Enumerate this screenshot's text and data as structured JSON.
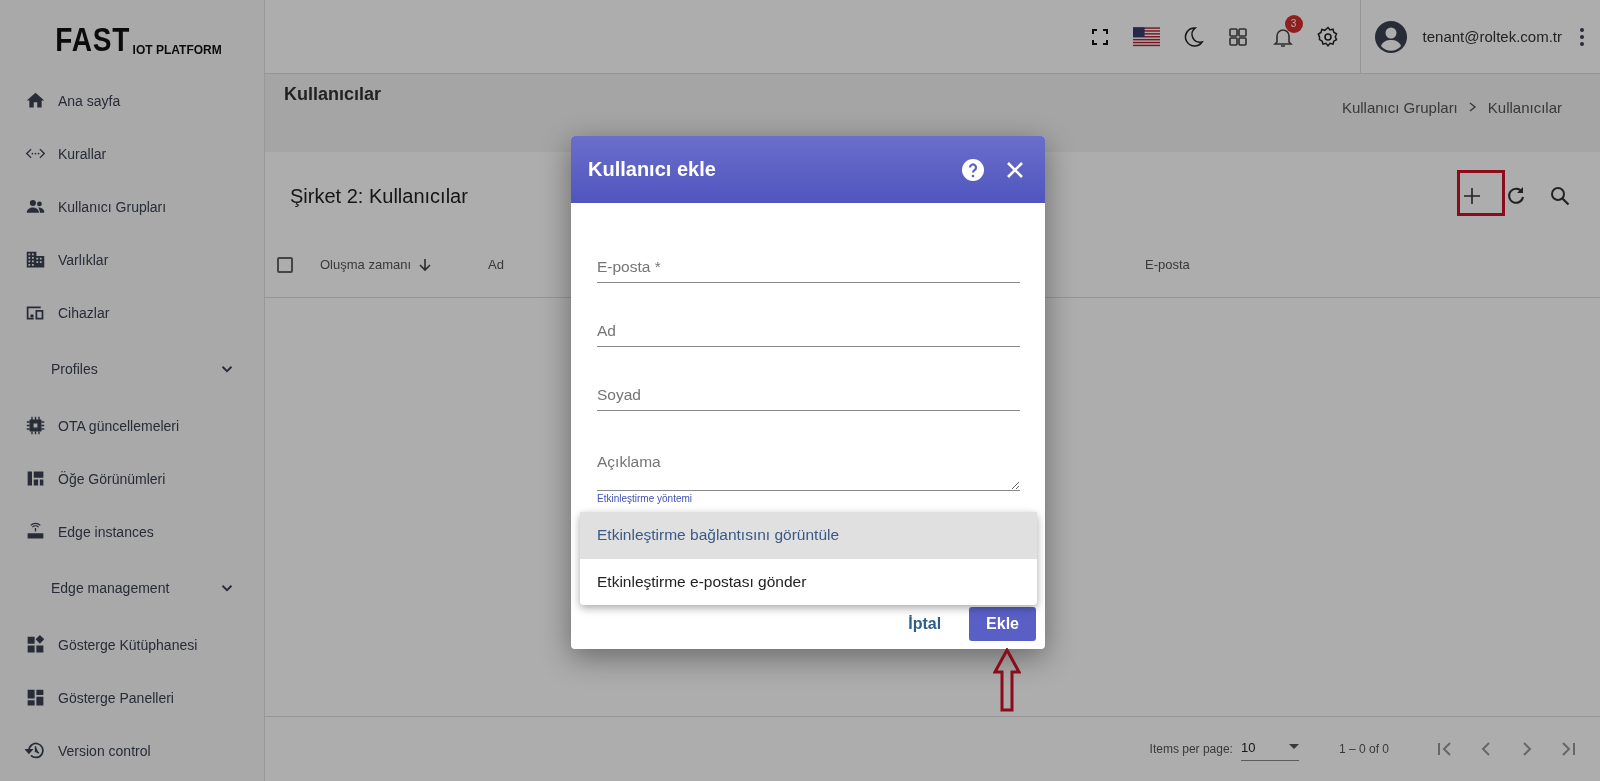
{
  "header": {
    "logo_main": "FAST",
    "logo_sub": "IOT PLATFORM",
    "notification_count": "3",
    "user_email": "tenant@roltek.com.tr"
  },
  "sidebar": {
    "items": [
      {
        "kind": "link",
        "label": "Ana sayfa"
      },
      {
        "kind": "link",
        "label": "Kurallar"
      },
      {
        "kind": "link",
        "label": "Kullanıcı Grupları"
      },
      {
        "kind": "link",
        "label": "Varlıklar"
      },
      {
        "kind": "link",
        "label": "Cihazlar"
      },
      {
        "kind": "section",
        "label": "Profiles"
      },
      {
        "kind": "link",
        "label": "OTA güncellemeleri"
      },
      {
        "kind": "link",
        "label": "Öğe Görünümleri"
      },
      {
        "kind": "link",
        "label": "Edge instances"
      },
      {
        "kind": "section",
        "label": "Edge management"
      },
      {
        "kind": "link",
        "label": "Gösterge Kütüphanesi"
      },
      {
        "kind": "link",
        "label": "Gösterge Panelleri"
      },
      {
        "kind": "link",
        "label": "Version control"
      }
    ]
  },
  "page": {
    "title": "Kullanıcılar",
    "breadcrumbs": [
      "Kullanıcı Grupları",
      "Kullanıcılar"
    ]
  },
  "card": {
    "title": "Şirket 2: Kullanıcılar",
    "columns": [
      {
        "label": "Oluşma zamanı",
        "sorted": true
      },
      {
        "label": "Ad"
      },
      {
        "label": "E-posta"
      }
    ],
    "select_all": {
      "checked": false
    },
    "pagination": {
      "label": "Items per page:",
      "page_size": "10",
      "range": "1 – 0 of 0"
    }
  },
  "dialog": {
    "title": "Kullanıcı ekle",
    "fields": [
      {
        "kind": "input",
        "placeholder": "E-posta *"
      },
      {
        "kind": "input",
        "placeholder": "Ad"
      },
      {
        "kind": "input",
        "placeholder": "Soyad"
      },
      {
        "kind": "textarea",
        "placeholder": "Açıklama"
      }
    ],
    "select_label": "Etkinleştirme yöntemi",
    "options": [
      {
        "label": "Etkinleştirme bağlantısını görüntüle",
        "selected": true
      },
      {
        "label": "Etkinleştirme e-postası gönder",
        "selected": false
      }
    ],
    "buttons": [
      {
        "kind": "text",
        "label": "İptal"
      },
      {
        "kind": "primary",
        "label": "Ekle"
      }
    ]
  },
  "annotations": [
    {
      "kind": "frame"
    },
    {
      "kind": "arrow"
    }
  ]
}
